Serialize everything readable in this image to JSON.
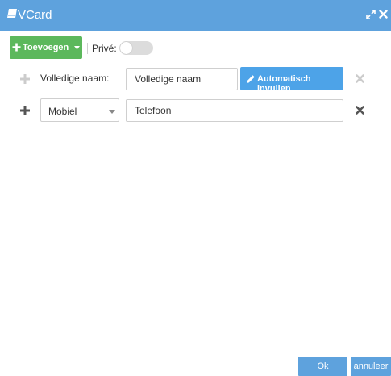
{
  "window": {
    "title": "VCard",
    "icons": {
      "title": "notebook-icon",
      "expand": "expand-icon",
      "close": "close-icon"
    }
  },
  "toolbar": {
    "add_label": "Toevoegen",
    "prive_label": "Privé:",
    "prive_on": false
  },
  "rows": [
    {
      "label": "Volledige naam:",
      "input_value": "",
      "input_placeholder": "Volledige naam",
      "button_label": "Automatisch invullen"
    },
    {
      "type_value": "Mobiel",
      "input_value": "",
      "input_placeholder": "Telefoon"
    }
  ],
  "footer": {
    "ok_label": "Ok",
    "cancel_label": "annuleer"
  },
  "colors": {
    "titlebar": "#5ea2dd",
    "add_button": "#5cb85c",
    "auto_button": "#4da3e8",
    "icon_disabled": "#cccccc",
    "icon_active": "#555555"
  }
}
